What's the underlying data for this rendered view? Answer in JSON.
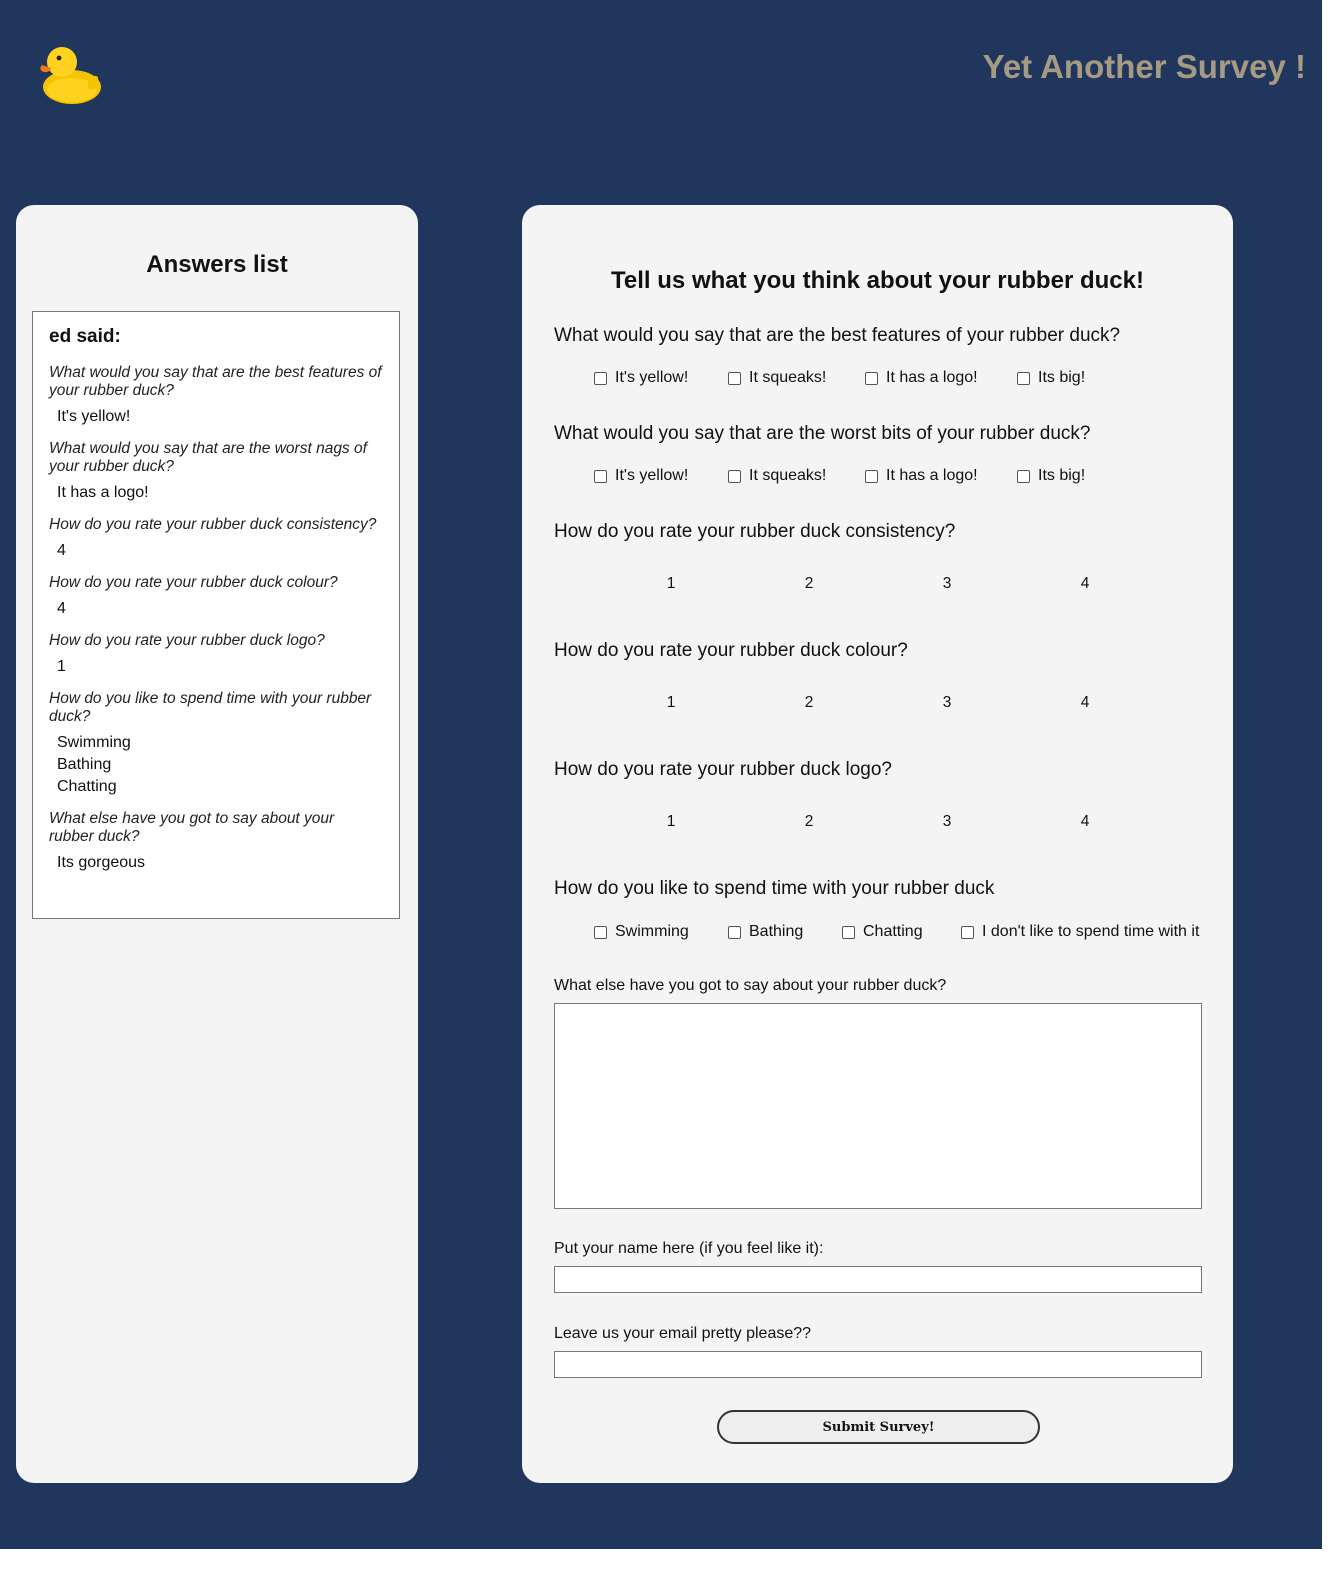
{
  "header": {
    "logo_icon": "rubber-duck-icon",
    "site_title": "Yet Another Survey !"
  },
  "answers": {
    "title": "Answers list",
    "entries": [
      {
        "author_line": "ed said:",
        "items": [
          {
            "question": "What would you say that are the best features of your rubber duck?",
            "answers": [
              "It's yellow!"
            ]
          },
          {
            "question": "What would you say that are the worst nags of your rubber duck?",
            "answers": [
              "It has a logo!"
            ]
          },
          {
            "question": "How do you rate your rubber duck consistency?",
            "answers": [
              "4"
            ]
          },
          {
            "question": "How do you rate your rubber duck colour?",
            "answers": [
              "4"
            ]
          },
          {
            "question": "How do you rate your rubber duck logo?",
            "answers": [
              "1"
            ]
          },
          {
            "question": "How do you like to spend time with your rubber duck?",
            "answers": [
              "Swimming",
              "Bathing",
              "Chatting"
            ]
          },
          {
            "question": "What else have you got to say about your rubber duck?",
            "answers": [
              "Its gorgeous"
            ]
          }
        ]
      }
    ]
  },
  "survey": {
    "title": "Tell us what you think about your rubber duck!",
    "q_best": {
      "label": "What would you say that are the best features of your rubber duck?",
      "options": [
        "It's yellow!",
        "It squeaks!",
        "It has a logo!",
        "Its big!"
      ]
    },
    "q_worst": {
      "label": "What would you say that are the worst bits of your rubber duck?",
      "options": [
        "It's yellow!",
        "It squeaks!",
        "It has a logo!",
        "Its big!"
      ]
    },
    "q_consistency": {
      "label": "How do you rate your rubber duck consistency?",
      "options": [
        "1",
        "2",
        "3",
        "4"
      ]
    },
    "q_colour": {
      "label": "How do you rate your rubber duck colour?",
      "options": [
        "1",
        "2",
        "3",
        "4"
      ]
    },
    "q_logo": {
      "label": "How do you rate your rubber duck logo?",
      "options": [
        "1",
        "2",
        "3",
        "4"
      ]
    },
    "q_time": {
      "label": "How do you like to spend time with your rubber duck",
      "options": [
        "Swimming",
        "Bathing",
        "Chatting",
        "I don't like to spend time with it"
      ]
    },
    "comments": {
      "label": "What else have you got to say about your rubber duck?",
      "value": ""
    },
    "name": {
      "label": "Put your name here (if you feel like it):",
      "value": ""
    },
    "email": {
      "label": "Leave us your email pretty please??",
      "value": ""
    },
    "submit_label": "Submit Survey!"
  }
}
